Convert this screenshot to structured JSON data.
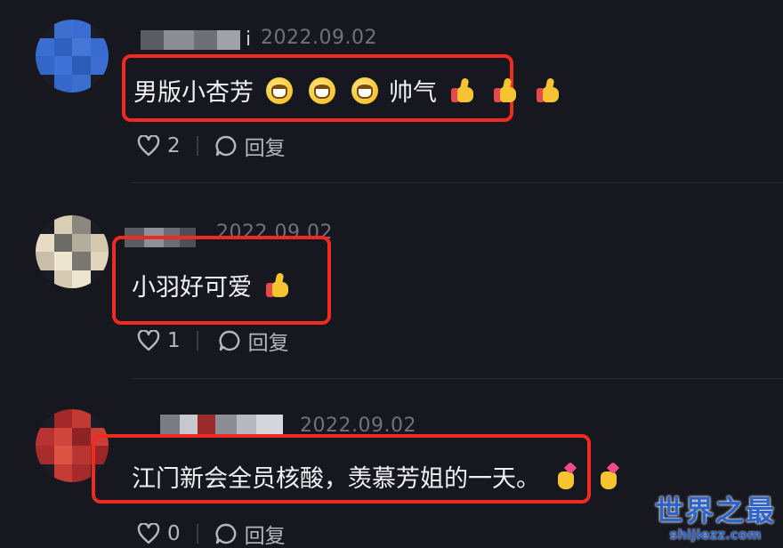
{
  "comments": [
    {
      "date": "2022.09.02",
      "text": "男版小杏芳",
      "emojis_a": [
        "grinning-face",
        "grinning-face",
        "grinning-face"
      ],
      "text_after": "帅气",
      "emojis_b": [
        "thumbs-up",
        "thumbs-up",
        "thumbs-up"
      ],
      "likes": "2",
      "reply_label": "回复",
      "username_fragment": "i"
    },
    {
      "date": "2022.09.02",
      "text": "小羽好可爱",
      "emojis_b": [
        "thumbs-up"
      ],
      "likes": "1",
      "reply_label": "回复"
    },
    {
      "date": "2022.09.02",
      "text": "江门新会全员核酸，羡慕芳姐的一天。",
      "emojis_b": [
        "heart-hands",
        "heart-hands"
      ],
      "likes": "0",
      "reply_label": "回复"
    }
  ],
  "highlight_color": "#f02a1f",
  "watermark": {
    "title": "世界之最",
    "url": "shijiezz.com"
  }
}
